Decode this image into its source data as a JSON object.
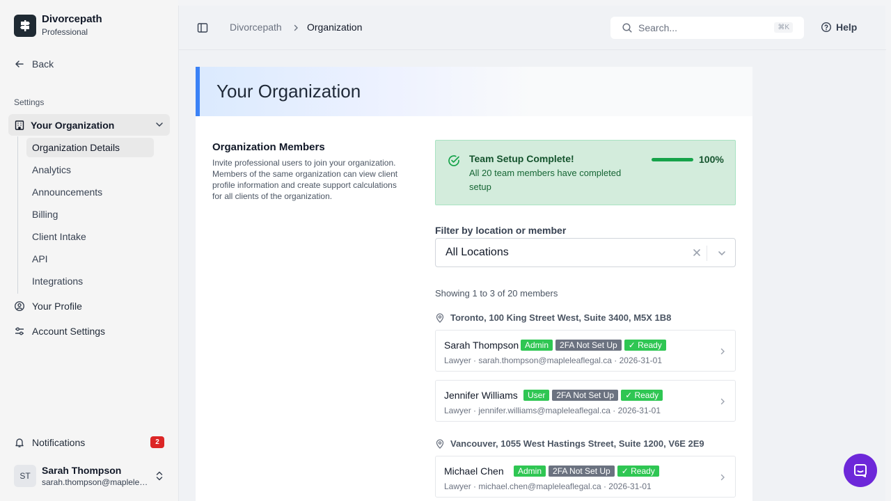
{
  "brand": {
    "name": "Divorcepath",
    "plan": "Professional"
  },
  "sidebar": {
    "back_label": "Back",
    "section_label": "Settings",
    "org_label": "Your Organization",
    "sub_items": [
      {
        "label": "Organization Details"
      },
      {
        "label": "Analytics"
      },
      {
        "label": "Announcements"
      },
      {
        "label": "Billing"
      },
      {
        "label": "Client Intake"
      },
      {
        "label": "API"
      },
      {
        "label": "Integrations"
      }
    ],
    "profile_label": "Your Profile",
    "account_label": "Account Settings",
    "notifications_label": "Notifications",
    "notifications_count": "2",
    "user": {
      "initials": "ST",
      "name": "Sarah Thompson",
      "email": "sarah.thompson@mapleleafiegal.ca"
    }
  },
  "topbar": {
    "breadcrumb": [
      "Divorcepath",
      "Organization"
    ],
    "search_placeholder": "Search...",
    "search_shortcut": "⌘K",
    "help_label": "Help"
  },
  "page": {
    "title": "Your Organization",
    "members_title": "Organization Members",
    "members_desc": "Invite professional users to join your organization. Members of the same organization can view client profile information and create support calculations for all clients of the organization."
  },
  "status": {
    "title": "Team Setup Complete!",
    "desc": "All 20 team members have completed setup",
    "progress": 1.0,
    "progress_label": "100%"
  },
  "filter": {
    "label": "Filter by location or member",
    "value": "All Locations"
  },
  "showing": "Showing 1 to 3 of 20 members",
  "locations": [
    {
      "label": "Toronto, 100 King Street West, Suite 3400, M5X 1B8"
    },
    {
      "label": "Vancouver, 1055 West Hastings Street, Suite 1200, V6E 2E9"
    }
  ],
  "members": [
    {
      "name": "Sarah Thompson",
      "role_tag": "Admin",
      "twofa_tag": "2FA Not Set Up",
      "ready_tag": "✓ Ready",
      "sub": "Lawyer · sarah.thompson@mapleleaflegal.ca · 2026-31-01"
    },
    {
      "name": "Jennifer Williams",
      "role_tag": "User",
      "twofa_tag": "2FA Not Set Up",
      "ready_tag": "✓ Ready",
      "sub": "Lawyer · jennifer.williams@mapleleaflegal.ca · 2026-31-01"
    },
    {
      "name": "Michael Chen",
      "role_tag": "Admin",
      "twofa_tag": "2FA Not Set Up",
      "ready_tag": "✓ Ready",
      "sub": "Lawyer · michael.chen@mapleleaflegal.ca · 2026-31-01"
    }
  ],
  "colors": {
    "accent": "#3b82f6",
    "success": "#16a34a",
    "tag_green": "#2fc653",
    "tag_gray": "#6b7280",
    "chat": "#6d28d9",
    "badge": "#dc2626"
  }
}
